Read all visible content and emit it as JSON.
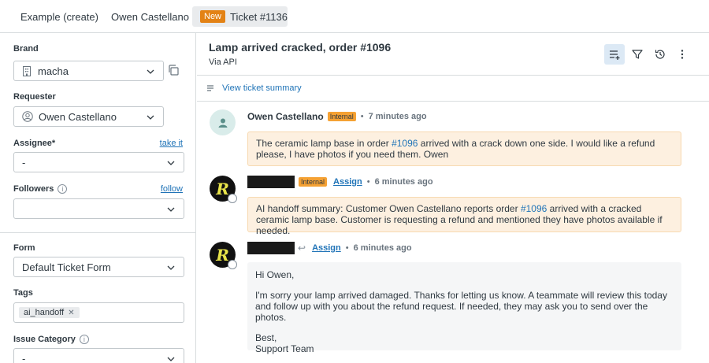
{
  "tabs": [
    {
      "label": "Example (create)"
    },
    {
      "label": "Owen Castellano"
    },
    {
      "label": "Ticket #1136",
      "badge": "New"
    }
  ],
  "sidebar": {
    "brand": {
      "label": "Brand",
      "value": "macha"
    },
    "requester": {
      "label": "Requester",
      "value": "Owen Castellano"
    },
    "assignee": {
      "label": "Assignee*",
      "value": "-",
      "link": "take it"
    },
    "followers": {
      "label": "Followers",
      "value": "",
      "link": "follow"
    },
    "form": {
      "label": "Form",
      "value": "Default Ticket Form"
    },
    "tags": {
      "label": "Tags",
      "items": [
        "ai_handoff"
      ]
    },
    "issue_category": {
      "label": "Issue Category",
      "value": "-"
    }
  },
  "ticket": {
    "subject": "Lamp arrived cracked, order #1096",
    "via": "Via API",
    "summary_link": "View ticket summary"
  },
  "messages": [
    {
      "author": "Owen Castellano",
      "badge": "Internal",
      "time": "7 minutes ago",
      "body_pre": "The ceramic lamp base in order ",
      "body_link": "#1096",
      "body_post": " arrived with a crack down one side. I would like a refund please, I have photos if you need them. Owen"
    },
    {
      "author": "",
      "badge": "Internal",
      "assign": "Assign",
      "time": "6 minutes ago",
      "body_pre": "AI handoff summary: Customer Owen Castellano reports order ",
      "body_link": "#1096",
      "body_post": " arrived with a cracked ceramic lamp base. Customer is requesting a refund and mentioned they have photos available if needed."
    },
    {
      "author": "",
      "assign": "Assign",
      "time": "6 minutes ago",
      "greeting": "Hi Owen,",
      "body": "I'm sorry your lamp arrived damaged. Thanks for letting us know. A teammate will review this today and follow up with you about the refund request. If needed, they may ask you to send over the photos.",
      "signoff": "Best,",
      "signature": "Support Team"
    }
  ],
  "colors": {
    "link": "#1f73b7",
    "internal_bg": "#fdf0e0",
    "new_badge": "#e38215"
  },
  "icons": [
    "building-icon",
    "user-circle-icon",
    "chevron-down-icon",
    "copy-icon",
    "info-icon",
    "add-list-icon",
    "filter-icon",
    "history-icon",
    "more-vertical-icon",
    "summary-icon",
    "reply-arrow-icon"
  ]
}
